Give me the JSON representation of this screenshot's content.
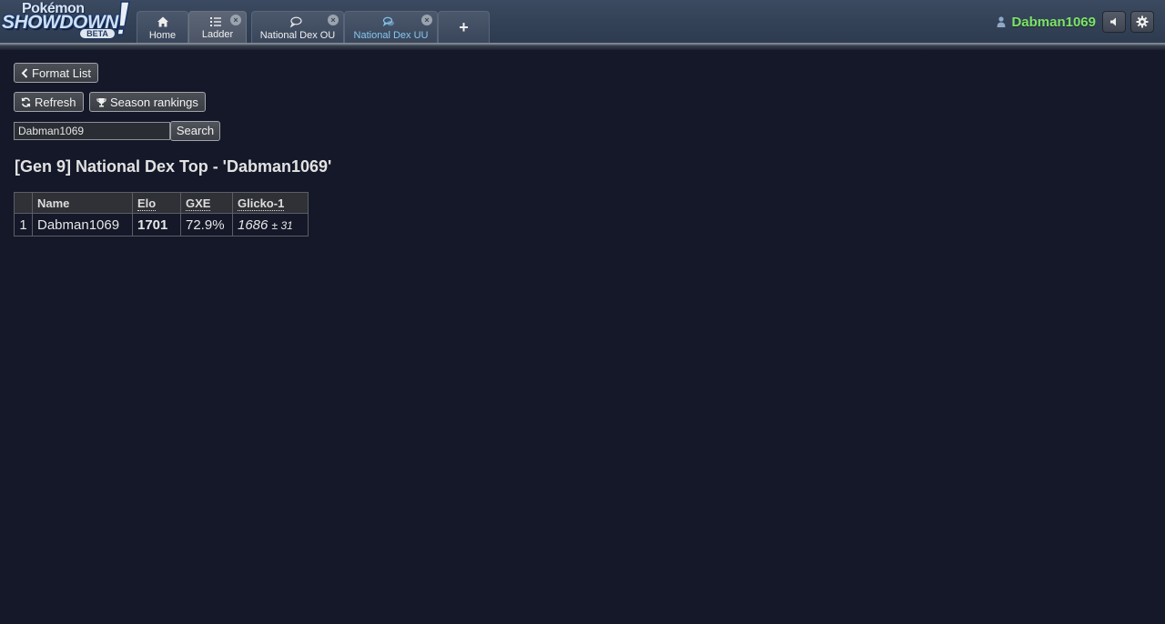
{
  "header": {
    "logo": {
      "line1": "Pokémon",
      "line2": "SHOWDOWN",
      "badge": "BETA"
    },
    "tabs": [
      {
        "label": "Home",
        "icon": "home-icon",
        "closable": false,
        "active": false
      },
      {
        "label": "Ladder",
        "icon": "list-icon",
        "closable": true,
        "active": true
      },
      {
        "label": "National Dex OU",
        "icon": "chat-bubble-icon",
        "closable": true,
        "active": false
      },
      {
        "label": "National Dex UU",
        "icon": "chat-bubbles-icon",
        "closable": true,
        "active": false,
        "highlight": "#86c8f0"
      }
    ],
    "new_tab_label": "+",
    "close_glyph": "×",
    "user": {
      "name": "Dabman1069",
      "name_color": "#7be36b"
    }
  },
  "toolbar": {
    "format_list_label": "Format List",
    "refresh_label": "Refresh",
    "season_label": "Season rankings"
  },
  "search": {
    "value": "Dabman1069",
    "button_label": "Search"
  },
  "page_title": "[Gen 9] National Dex Top - 'Dabman1069'",
  "table": {
    "headers": [
      "Name",
      "Elo",
      "GXE",
      "Glicko-1"
    ],
    "rows": [
      {
        "rank": "1",
        "name": "Dabman1069",
        "elo": "1701",
        "gxe": "72.9%",
        "glicko": "1686",
        "glicko_dev": "± 31"
      }
    ]
  },
  "colors": {
    "background": "#141828",
    "header": "#3b4a60",
    "username": "#7be36b",
    "highlight_tab": "#86c8f0"
  }
}
